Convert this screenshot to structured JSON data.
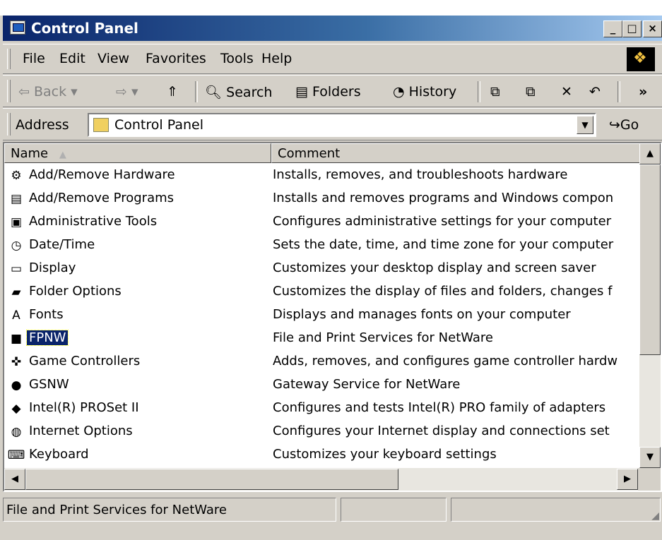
{
  "window": {
    "title": "Control Panel",
    "minimize": "_",
    "maximize": "□",
    "close": "×"
  },
  "menu": {
    "items": [
      "File",
      "Edit",
      "View",
      "Favorites",
      "Tools",
      "Help"
    ]
  },
  "toolbar": {
    "back": "Back",
    "back_arrow": "⇦",
    "forward_arrow": "⇨",
    "up": "⇑",
    "search": "Search",
    "folders": "Folders",
    "history": "History",
    "more": "»"
  },
  "address": {
    "label": "Address",
    "value": "Control Panel",
    "go": "Go"
  },
  "list": {
    "columns": [
      "Name",
      "Comment"
    ],
    "sort_indicator": "▲",
    "rows": [
      {
        "icon": "add-remove-hardware-icon",
        "glyph": "⚙",
        "name": "Add/Remove Hardware",
        "comment": "Installs, removes, and troubleshoots hardware"
      },
      {
        "icon": "add-remove-programs-icon",
        "glyph": "▤",
        "name": "Add/Remove Programs",
        "comment": "Installs and removes programs and Windows compon"
      },
      {
        "icon": "administrative-tools-icon",
        "glyph": "▣",
        "name": "Administrative Tools",
        "comment": "Configures administrative settings for your computer"
      },
      {
        "icon": "date-time-icon",
        "glyph": "◷",
        "name": "Date/Time",
        "comment": "Sets the date, time, and time zone for your computer"
      },
      {
        "icon": "display-icon",
        "glyph": "▭",
        "name": "Display",
        "comment": "Customizes your desktop display and screen saver"
      },
      {
        "icon": "folder-options-icon",
        "glyph": "▰",
        "name": "Folder Options",
        "comment": "Customizes the display of files and folders, changes f"
      },
      {
        "icon": "fonts-icon",
        "glyph": "A",
        "name": "Fonts",
        "comment": "Displays and manages fonts on your computer"
      },
      {
        "icon": "fpnw-icon",
        "glyph": "■",
        "name": "FPNW",
        "comment": "File and Print Services for NetWare"
      },
      {
        "icon": "game-controllers-icon",
        "glyph": "✜",
        "name": "Game Controllers",
        "comment": "Adds, removes, and configures game controller hardw"
      },
      {
        "icon": "gsnw-icon",
        "glyph": "●",
        "name": "GSNW",
        "comment": "Gateway Service for NetWare"
      },
      {
        "icon": "intel-proset-icon",
        "glyph": "◆",
        "name": "Intel(R) PROSet II",
        "comment": "Configures and tests Intel(R) PRO family of adapters"
      },
      {
        "icon": "internet-options-icon",
        "glyph": "◍",
        "name": "Internet Options",
        "comment": "Configures your Internet display and connections set"
      },
      {
        "icon": "keyboard-icon",
        "glyph": "⌨",
        "name": "Keyboard",
        "comment": "Customizes your keyboard settings"
      }
    ],
    "selected_row": 7
  },
  "status": {
    "text": "File and Print Services for NetWare"
  },
  "colors": {
    "title_start": "#0a246a",
    "title_end": "#a6caf0",
    "selection": "#0a246a",
    "face": "#d4d0c8"
  }
}
